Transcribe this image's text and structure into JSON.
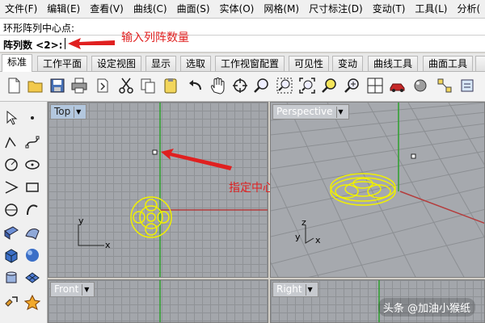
{
  "menu": [
    {
      "id": "file",
      "label": "文件(F)"
    },
    {
      "id": "edit",
      "label": "编辑(E)"
    },
    {
      "id": "view",
      "label": "查看(V)"
    },
    {
      "id": "curve",
      "label": "曲线(C)"
    },
    {
      "id": "surface",
      "label": "曲面(S)"
    },
    {
      "id": "solid",
      "label": "实体(O)"
    },
    {
      "id": "mesh",
      "label": "网格(M)"
    },
    {
      "id": "dimension",
      "label": "尺寸标注(D)"
    },
    {
      "id": "transform",
      "label": "变动(T)"
    },
    {
      "id": "tools",
      "label": "工具(L)"
    },
    {
      "id": "analyze",
      "label": "分析("
    }
  ],
  "command": {
    "history": "环形阵列中心点:",
    "prompt": "阵列数 <2>:"
  },
  "tabs": [
    {
      "id": "standard",
      "label": "标准"
    },
    {
      "id": "cplanes",
      "label": "工作平面"
    },
    {
      "id": "setview",
      "label": "设定视图"
    },
    {
      "id": "display",
      "label": "显示"
    },
    {
      "id": "select",
      "label": "选取"
    },
    {
      "id": "vplayout",
      "label": "工作视窗配置"
    },
    {
      "id": "visibility",
      "label": "可见性"
    },
    {
      "id": "transform",
      "label": "变动"
    },
    {
      "id": "curvetools",
      "label": "曲线工具"
    },
    {
      "id": "surfacetools",
      "label": "曲面工具"
    },
    {
      "id": "more",
      "label": ""
    }
  ],
  "toolbar": [
    "new-file-icon",
    "open-folder-icon",
    "save-icon",
    "print-icon",
    "import-icon",
    "cut-icon",
    "copy-icon",
    "paste-icon",
    "undo-icon",
    "pan-hand-icon",
    "rotate-view-icon",
    "zoom-icon",
    "zoom-window-icon",
    "zoom-extents-icon",
    "zoom-selected-icon",
    "four-viewports-icon",
    "car-render-icon",
    "grid-snap-icon"
  ],
  "sidebar_tools": [
    "select-arrow-icon",
    "point-icon",
    "polyline-icon",
    "curve-icon",
    "circle-icon",
    "ellipse-icon",
    "arc-icon",
    "rectangle-icon",
    "polygon-icon",
    "freeform-curve-icon",
    "surface-icon",
    "patch-icon",
    "box-icon",
    "sphere-icon",
    "cylinder-icon",
    "mesh-icon",
    "transform-icon",
    "boolean-icon"
  ],
  "viewports": {
    "top": {
      "label": "Top"
    },
    "perspective": {
      "label": "Perspective"
    },
    "front": {
      "label": "Front"
    },
    "right": {
      "label": "Right"
    }
  },
  "axes": {
    "x": "x",
    "y": "y",
    "z": "z"
  },
  "annotations": {
    "input_count": "输入列阵数量",
    "center_point": "指定中心点"
  },
  "watermark": "头条 @加油小猴纸",
  "colors": {
    "annotation_red": "#e02020",
    "selected_object": "#f0f000",
    "x_axis": "#b43c3c",
    "y_axis": "#2ca02c"
  }
}
